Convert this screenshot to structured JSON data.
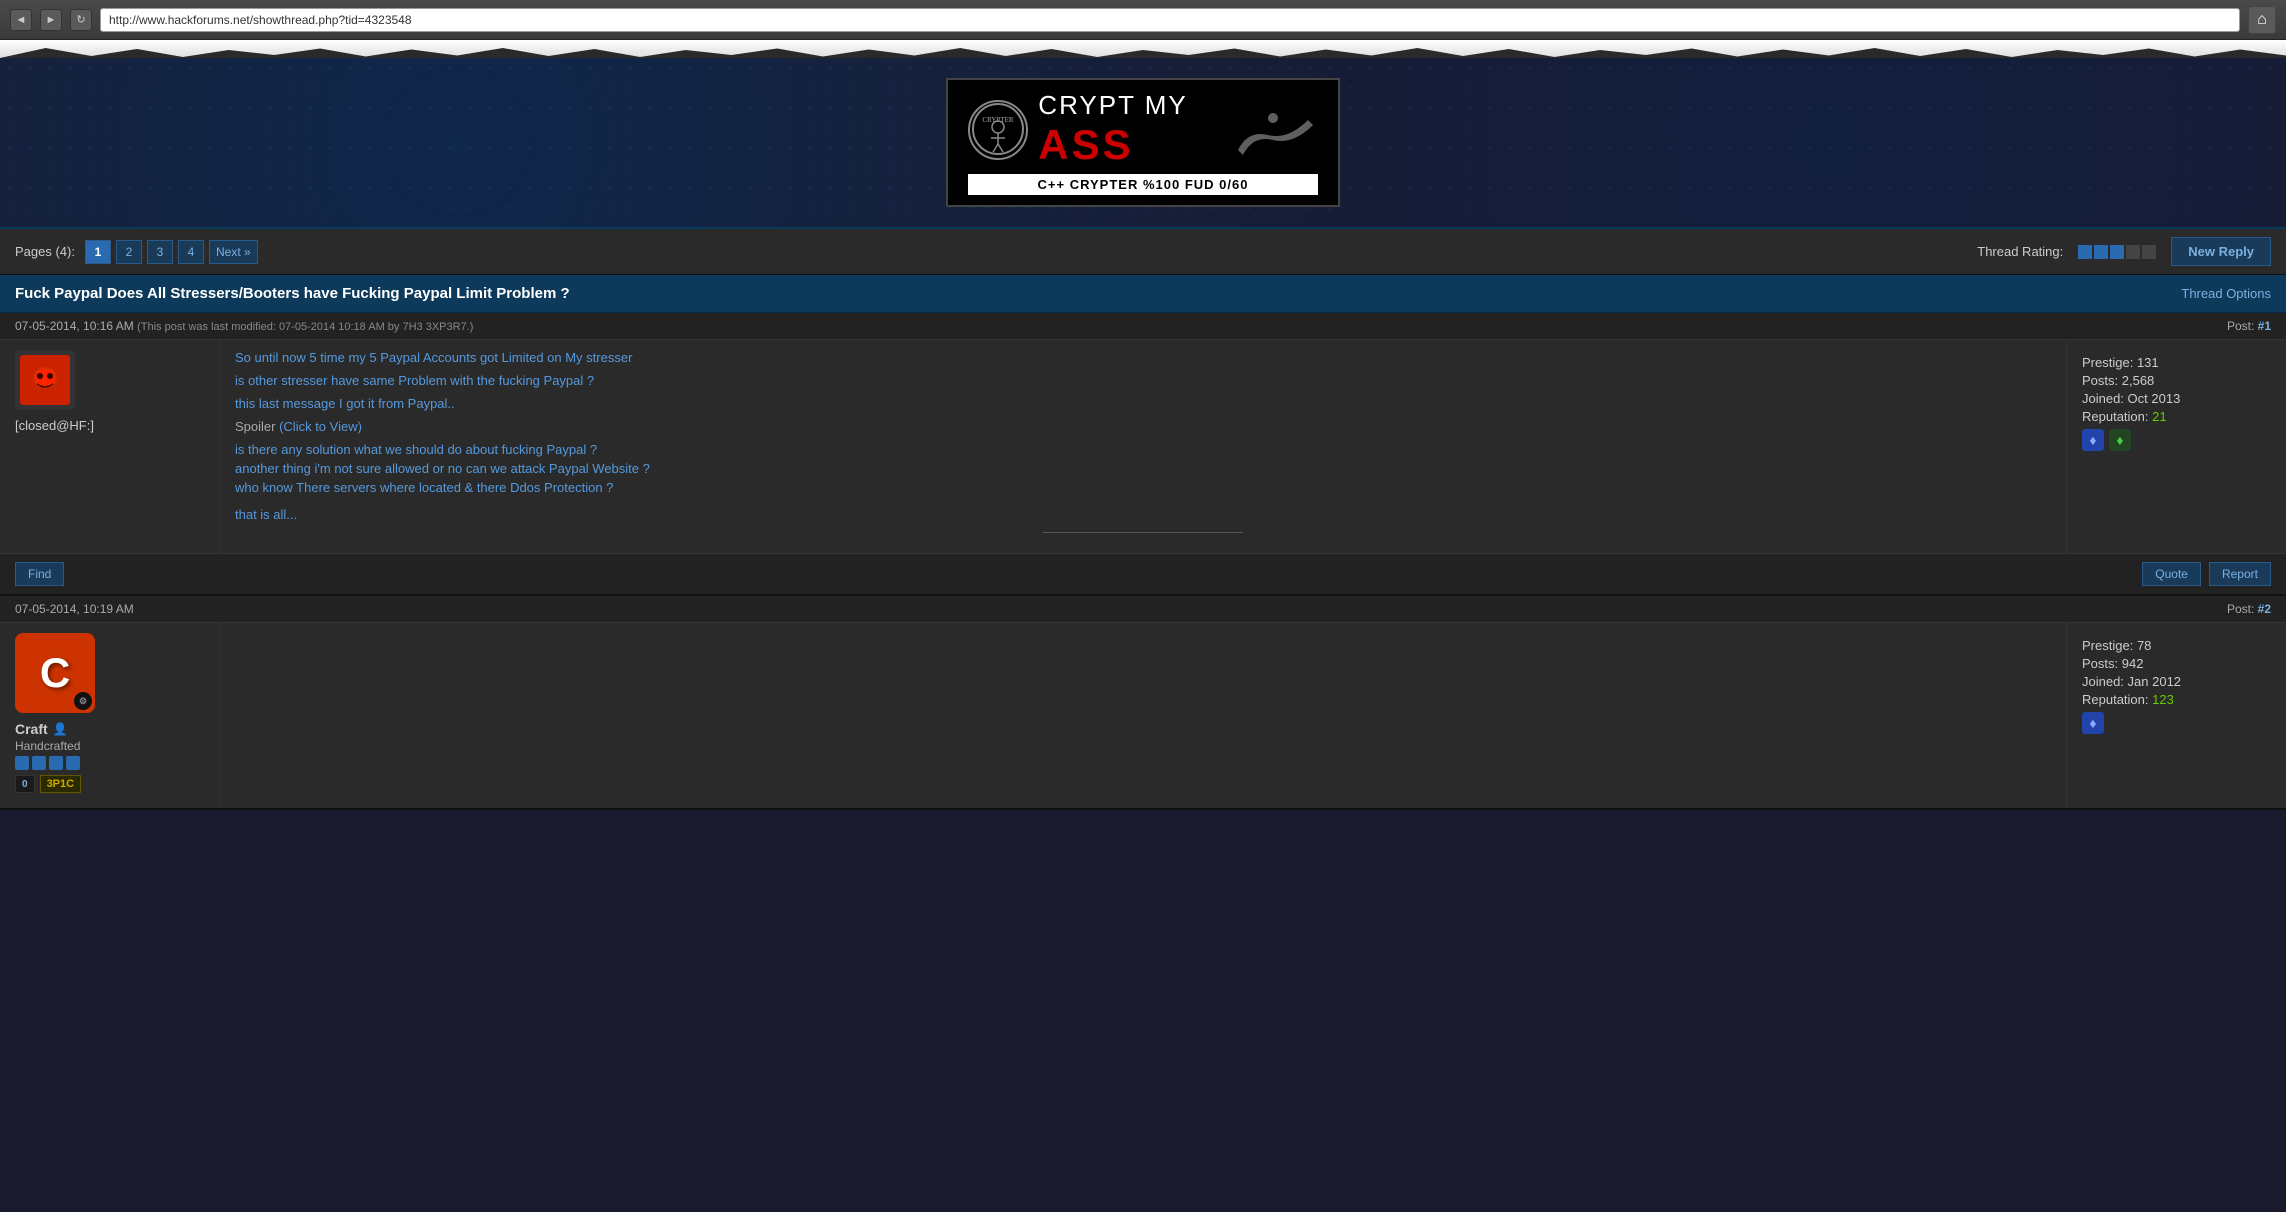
{
  "browser": {
    "url": "http://www.hackforums.net/showthread.php?tid=4323548",
    "back_btn": "◄",
    "forward_btn": "►",
    "refresh_btn": "↻",
    "home_btn": "⌂"
  },
  "banner": {
    "brand_top": "CRYPTER",
    "brand_main": "CRYPT MY",
    "brand_sub": "ASS",
    "tagline": "C++ CRYPTER  %100 FUD 0/60"
  },
  "page_controls": {
    "pages_label": "Pages (4):",
    "pages": [
      "1",
      "2",
      "3",
      "4"
    ],
    "active_page": "1",
    "next_label": "Next »",
    "thread_rating_label": "Thread Rating:",
    "new_reply_label": "New Reply"
  },
  "thread": {
    "title": "Fuck Paypal Does All Stressers/Booters have Fucking Paypal Limit Problem ?",
    "options_label": "Thread Options"
  },
  "post1": {
    "timestamp": "07-05-2014, 10:16 AM",
    "modified_note": "(This post was last modified: 07-05-2014 10:18 AM by 7H3 3XP3R7.)",
    "post_number": "#1",
    "post_number_label": "Post:",
    "username": "[closed@HF:]",
    "prestige_label": "Prestige:",
    "prestige_value": "131",
    "posts_label": "Posts:",
    "posts_value": "2,568",
    "joined_label": "Joined:",
    "joined_value": "Oct 2013",
    "reputation_label": "Reputation:",
    "reputation_value": "21",
    "content_line1": "So until now 5 time my 5 Paypal Accounts got Limited on My stresser",
    "content_line2": "is other stresser have same Problem with the fucking Paypal ?",
    "content_line3": "this last message I got it from Paypal..",
    "spoiler_label": "Spoiler",
    "spoiler_click": "(Click to View)",
    "content_line4": "is there any solution what we should do about fucking Paypal ?",
    "content_line5": "another thing i'm not sure allowed or no can we attack Paypal Website ?",
    "content_line6": "who know There servers where located & there Ddos Protection ?",
    "content_line7": "that is all...",
    "find_btn": "Find",
    "quote_btn": "Quote",
    "report_btn": "Report"
  },
  "post2": {
    "timestamp": "07-05-2014, 10:19 AM",
    "post_number": "#2",
    "post_number_label": "Post:",
    "username": "Craft",
    "online_icon": "👤",
    "user_title": "Handcrafted",
    "prestige_label": "Prestige:",
    "prestige_value": "78",
    "posts_label": "Posts:",
    "posts_value": "942",
    "joined_label": "Joined:",
    "joined_value": "Jan 2012",
    "reputation_label": "Reputation:",
    "reputation_value": "123",
    "avatar_letter": "C",
    "badge_number": "0",
    "badge_text": "3P1C"
  }
}
